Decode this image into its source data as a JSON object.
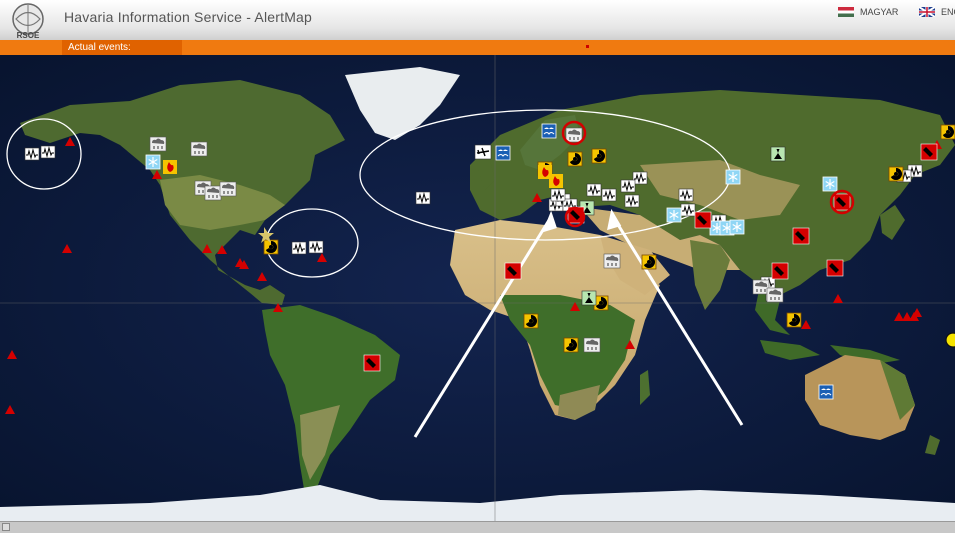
{
  "header": {
    "logo_text": "RSOE",
    "title": "Havaria Information Service - AlertMap",
    "lang_hu": "MAGYAR",
    "lang_en": "ENG"
  },
  "bar": {
    "actual_events": "Actual events:"
  },
  "colors": {
    "orange": "#f07a10",
    "ocean": "#0b1a3e",
    "alert_red": "#d40000",
    "icon_yellow": "#f5c400"
  },
  "icons": [
    "earthquake-icon",
    "volcano-triangle-icon",
    "radiation-icon",
    "snow-icon",
    "storm-icon",
    "flood-icon",
    "epidemic-icon",
    "fire-icon",
    "wind-icon",
    "biohazard-icon",
    "aircraft-icon"
  ]
}
